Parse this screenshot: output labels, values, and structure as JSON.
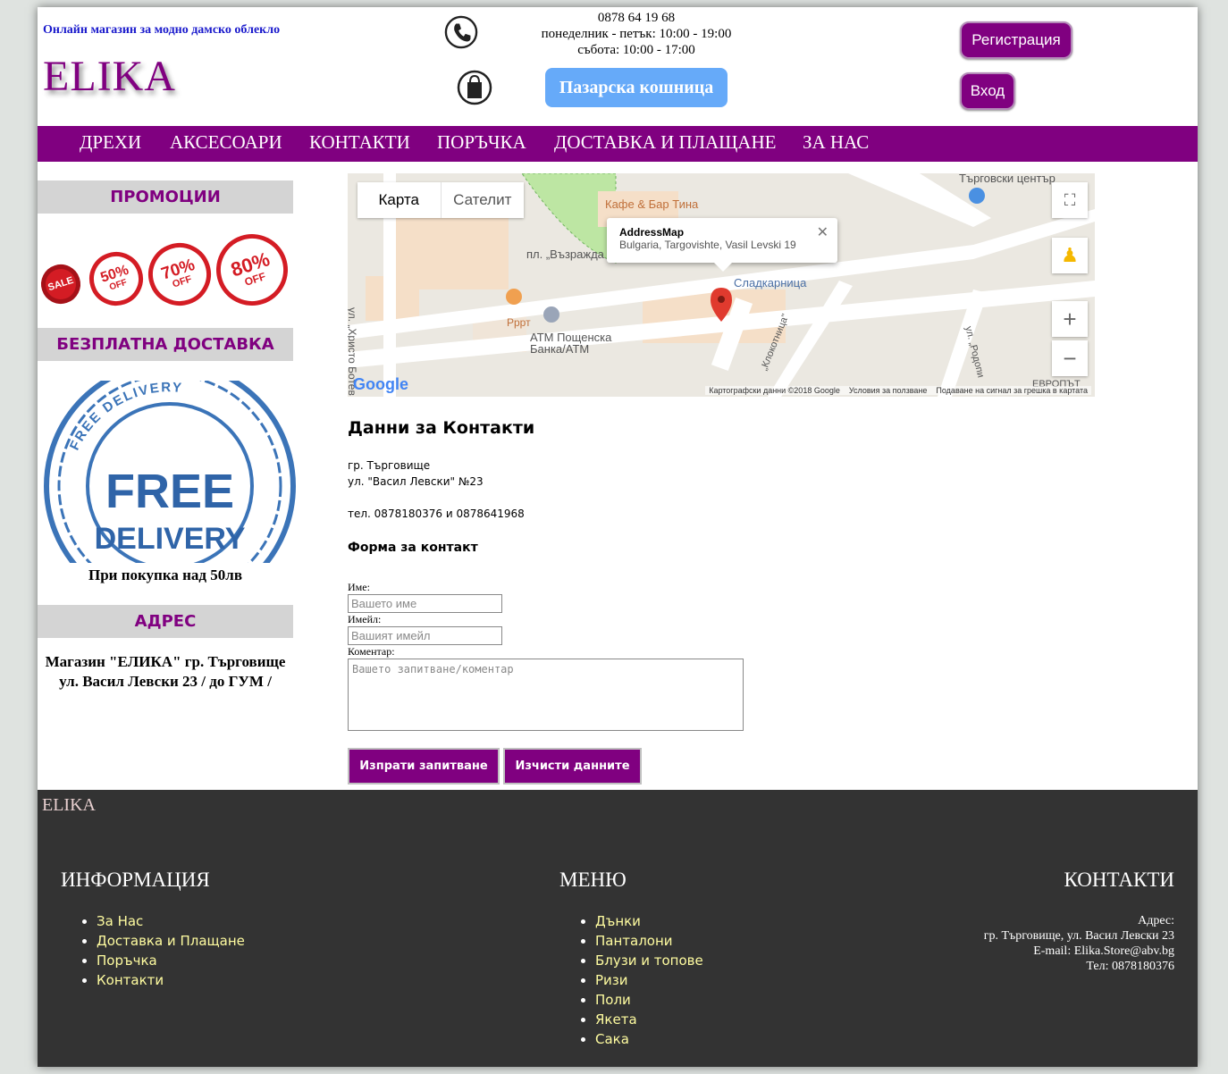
{
  "header": {
    "tagline": "Онлайн магазин за модно дамско облекло",
    "logo": "ELIKA",
    "phone": "0878 64 19 68",
    "hours_weekday": "понеделник - петък: 10:00 - 19:00",
    "hours_saturday": "събота: 10:00 - 17:00",
    "cart_label": "Пазарска кошница",
    "register_label": "Регистрация",
    "login_label": "Вход"
  },
  "nav": {
    "items": [
      {
        "label": "ДРЕХИ"
      },
      {
        "label": "АКСЕСОАРИ"
      },
      {
        "label": "КОНТАКТИ"
      },
      {
        "label": "ПОРЪЧКА"
      },
      {
        "label": "ДОСТАВКА И ПЛАЩАНЕ"
      },
      {
        "label": "ЗА НАС"
      }
    ]
  },
  "sidebar": {
    "promo_title": "ПРОМОЦИИ",
    "promo_badges": [
      {
        "top": "SALE"
      },
      {
        "top": "50%",
        "bottom": "OFF"
      },
      {
        "top": "70%",
        "bottom": "OFF"
      },
      {
        "top": "80%",
        "bottom": "OFF"
      }
    ],
    "delivery_title": "БЕЗПЛАТНА ДОСТАВКА",
    "delivery_image_text": {
      "ring": "FREE DELIVERY",
      "line1": "FREE",
      "line2": "DELIVERY"
    },
    "delivery_note": "При покупка над 50лв",
    "address_title": "АДРЕС",
    "address_line1": "Магазин \"ЕЛИКА\" гр. Търговище",
    "address_line2": "ул. Васил Левски 23 / до ГУМ /"
  },
  "map": {
    "tab_map": "Карта",
    "tab_satellite": "Сателит",
    "popup_title": "AddressMap",
    "popup_address": "Bulgaria, Targovishte, Vasil Levski 19",
    "labels": {
      "shopping_center": "Търговски център",
      "cafe": "Кафе & Бар Тина",
      "square": "пл. „Възражда",
      "street_botev": "ул. „Христо Ботев",
      "pastry": "Сладкарница",
      "pppt": "Рррт",
      "atm": "ATM Пощенска Банка/ATM",
      "street_klokotnitsa": "„Клокотница\"",
      "street_rodopi": "ул. „Родопи",
      "europe": "ЕВРОПЪТ"
    },
    "google": "Google",
    "footer_data": "Картографски данни ©2018 Google",
    "footer_terms": "Условия за ползване",
    "footer_report": "Подаване на сигнал за грешка в картата"
  },
  "contact": {
    "title": "Данни за Контакти",
    "city": "гр. Търговище",
    "street": "ул. \"Васил Левски\" №23",
    "phones": "тел. 0878180376 и 0878641968",
    "form_title": "Форма за контакт",
    "name_label": "Име:",
    "name_placeholder": "Вашето име",
    "email_label": "Имейл:",
    "email_placeholder": "Вашият имейл",
    "comment_label": "Коментар:",
    "comment_placeholder": "Вашето запитване/коментар",
    "submit_label": "Изпрати запитване",
    "clear_label": "Изчисти данните"
  },
  "footer": {
    "logo": "ELIKA",
    "info_title": "ИНФОРМАЦИЯ",
    "info_items": [
      "За Нас",
      "Доставка и Плащане",
      "Поръчка",
      "Контакти"
    ],
    "menu_title": "МЕНЮ",
    "menu_items": [
      "Дънки",
      "Панталони",
      "Блузи и топове",
      "Ризи",
      "Поли",
      "Якета",
      "Сака"
    ],
    "contacts_title": "КОНТАКТИ",
    "address_label": "Адрес:",
    "address": "гр. Търговище, ул. Васил Левски 23",
    "email": "E-mail: Elika.Store@abv.bg",
    "phone": "Тел: 0878180376"
  }
}
